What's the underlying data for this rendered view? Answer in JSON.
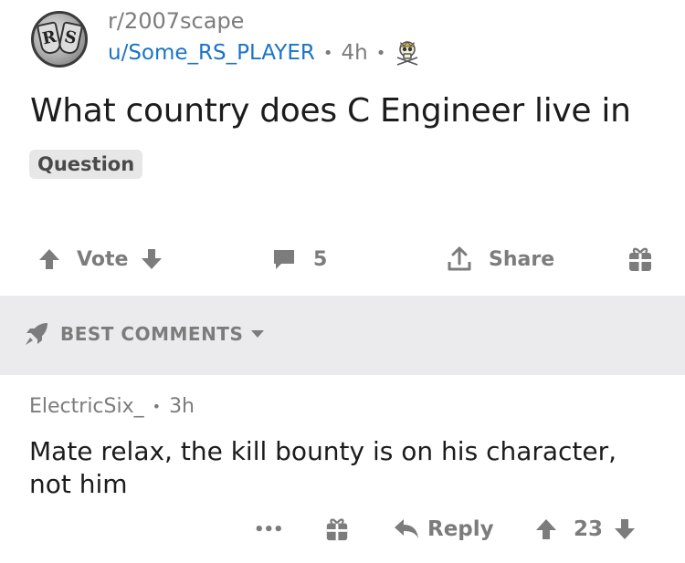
{
  "post": {
    "subreddit": "r/2007scape",
    "author": "u/Some_RS_PLAYER",
    "separator": "•",
    "age": "4h",
    "avatar_letters": {
      "left": "R",
      "right": "S"
    },
    "title": "What country does C Engineer live in",
    "flair": "Question",
    "actions": {
      "vote_label": "Vote",
      "comment_count": "5",
      "share_label": "Share"
    }
  },
  "comments_header": {
    "sort_label": "BEST COMMENTS"
  },
  "comment": {
    "author": "ElectricSix_",
    "separator": "•",
    "age": "3h",
    "body": "Mate relax, the kill bounty is on his character, not him",
    "more_label": "•••",
    "reply_label": "Reply",
    "score": "23"
  },
  "colors": {
    "username": "#1a73c8",
    "meta_gray": "#7c7c7c",
    "band_gray": "#ebebed",
    "text": "#1c1c1c"
  },
  "icons": [
    "skull-crossbones-icon",
    "upvote-arrow-icon",
    "downvote-arrow-icon",
    "comment-bubble-icon",
    "share-icon",
    "award-gift-icon",
    "rocket-icon",
    "caret-down-icon",
    "reply-arrow-icon"
  ]
}
